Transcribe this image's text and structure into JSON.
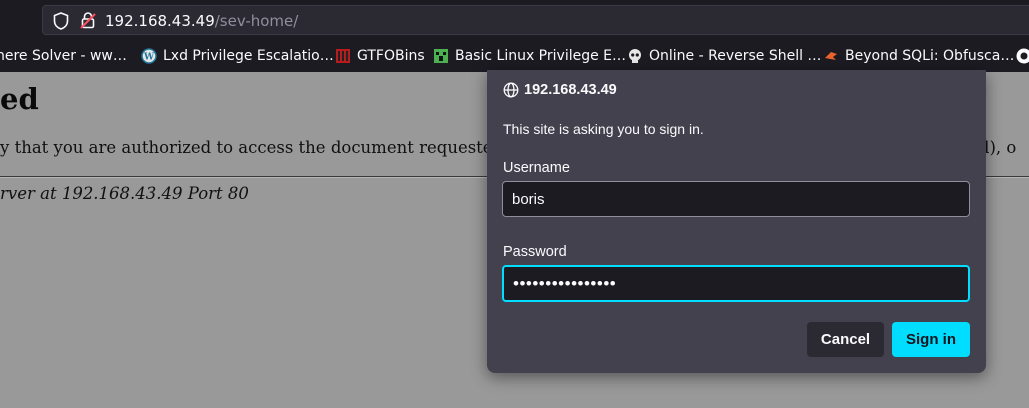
{
  "browser": {
    "url_host": "192.168.43.49",
    "url_path": "/sev-home/"
  },
  "bookmarks": [
    {
      "label": "nere Solver - ww…",
      "icon": "globe-icon"
    },
    {
      "label": "Lxd Privilege Escalatio…",
      "icon": "wordpress-icon"
    },
    {
      "label": "GTFOBins",
      "icon": "gtfobins-icon"
    },
    {
      "label": "Basic Linux Privilege E…",
      "icon": "creeper-icon"
    },
    {
      "label": "Online - Reverse Shell …",
      "icon": "skull-icon"
    },
    {
      "label": "Beyond SQLi: Obfusca…",
      "icon": "bird-icon"
    }
  ],
  "page": {
    "heading": "ed",
    "paragraph": "y that you are authorized to access the document requested",
    "paragraph_end": "rd), o",
    "address": "rver at 192.168.43.49 Port 80"
  },
  "dialog": {
    "origin": "192.168.43.49",
    "message": "This site is asking you to sign in.",
    "username_label": "Username",
    "username_value": "boris",
    "password_label": "Password",
    "password_value": "••••••••••••••••",
    "cancel_label": "Cancel",
    "signin_label": "Sign in"
  },
  "colors": {
    "accent": "#00ddff",
    "dialog_bg": "#42414d",
    "chrome_bg": "#1c1b22"
  }
}
